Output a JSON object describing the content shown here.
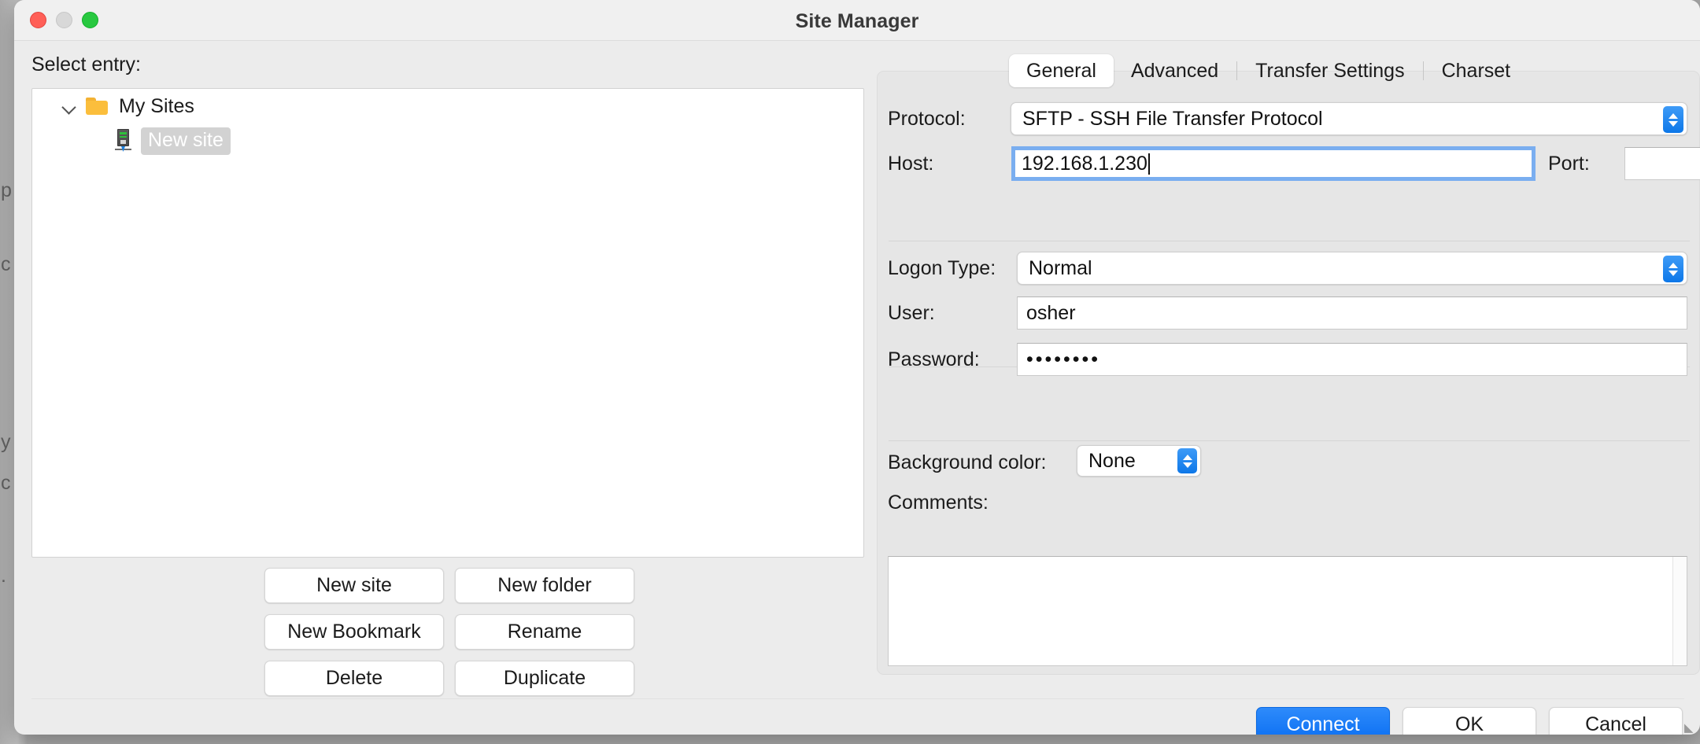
{
  "window": {
    "title": "Site Manager",
    "traffic_lights": [
      "close",
      "minimize",
      "zoom"
    ]
  },
  "left_pane": {
    "select_entry_label": "Select entry:",
    "tree": [
      {
        "label": "My Sites",
        "icon": "folder-icon",
        "expanded": true,
        "selected": false,
        "level": 0
      },
      {
        "label": "New site",
        "icon": "server-icon",
        "expanded": false,
        "selected": true,
        "level": 1
      }
    ],
    "buttons": [
      "New site",
      "New folder",
      "New Bookmark",
      "Rename",
      "Delete",
      "Duplicate"
    ]
  },
  "right_pane": {
    "tabs": [
      {
        "label": "General",
        "active": true
      },
      {
        "label": "Advanced",
        "active": false
      },
      {
        "label": "Transfer Settings",
        "active": false
      },
      {
        "label": "Charset",
        "active": false
      }
    ],
    "fields": {
      "protocol_label": "Protocol:",
      "protocol_value": "SFTP - SSH File Transfer Protocol",
      "host_label": "Host:",
      "host_value": "192.168.1.230",
      "host_focused": true,
      "port_label": "Port:",
      "port_value": "",
      "logon_type_label": "Logon Type:",
      "logon_type_value": "Normal",
      "user_label": "User:",
      "user_value": "osher",
      "password_label": "Password:",
      "password_value": "••••••••",
      "background_color_label": "Background color:",
      "background_color_value": "None",
      "comments_label": "Comments:",
      "comments_value": ""
    }
  },
  "footer": {
    "connect_label": "Connect",
    "ok_label": "OK",
    "cancel_label": "Cancel"
  },
  "colors": {
    "accent_blue": "#0a6ef2",
    "window_bg": "#ececec",
    "panel_bg": "#e6e6e6",
    "selection_gray": "#d2d2d2"
  },
  "background_window_glyphs": [
    "p",
    "c",
    "y",
    "c",
    "."
  ]
}
